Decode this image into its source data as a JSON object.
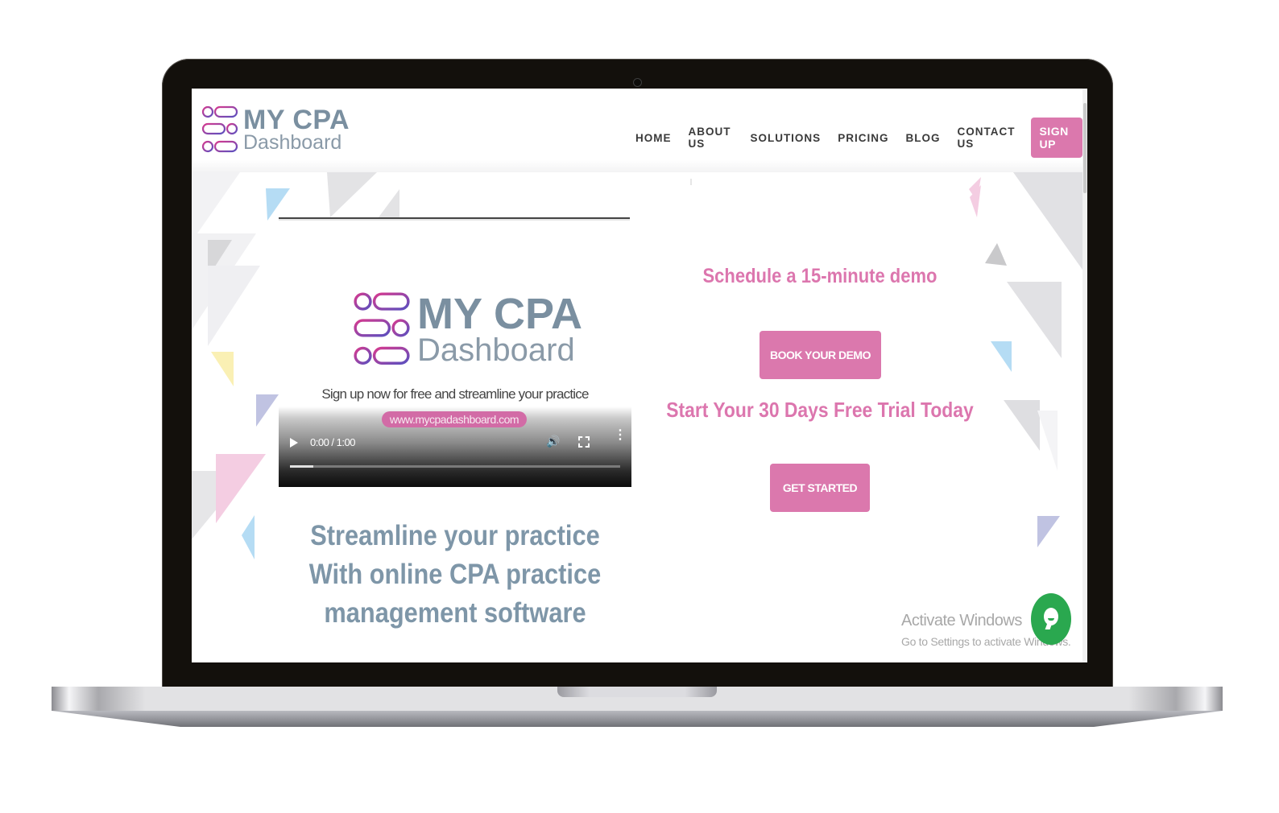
{
  "header": {
    "logo": {
      "line1": "MY CPA",
      "line2": "Dashboard"
    },
    "nav": [
      {
        "label": "HOME"
      },
      {
        "label": "ABOUT US"
      },
      {
        "label": "SOLUTIONS"
      },
      {
        "label": "PRICING"
      },
      {
        "label": "BLOG"
      },
      {
        "label": "CONTACT US"
      }
    ],
    "signup_label": "SIGN UP"
  },
  "video": {
    "logo_line1": "MY CPA",
    "logo_line2": "Dashboard",
    "tagline": "Sign up now for free and streamline your practice",
    "url": "www.mycpadashboard.com",
    "time": "0:00 / 1:00",
    "progress_percent": 7
  },
  "main": {
    "headline": "Streamline your practice With online CPA practice management software"
  },
  "cta": {
    "demo_title": "Schedule a 15-minute demo",
    "demo_button": "BOOK YOUR DEMO",
    "trial_title": "Start Your 30 Days Free Trial Today",
    "trial_button": "GET STARTED"
  },
  "watermark": {
    "line1": "Activate Windows",
    "line2": "Go to Settings to activate Windows."
  },
  "colors": {
    "brand_pink": "#db78ad",
    "brand_slate": "#7a8fa0",
    "chat_green": "#2aa84f"
  }
}
